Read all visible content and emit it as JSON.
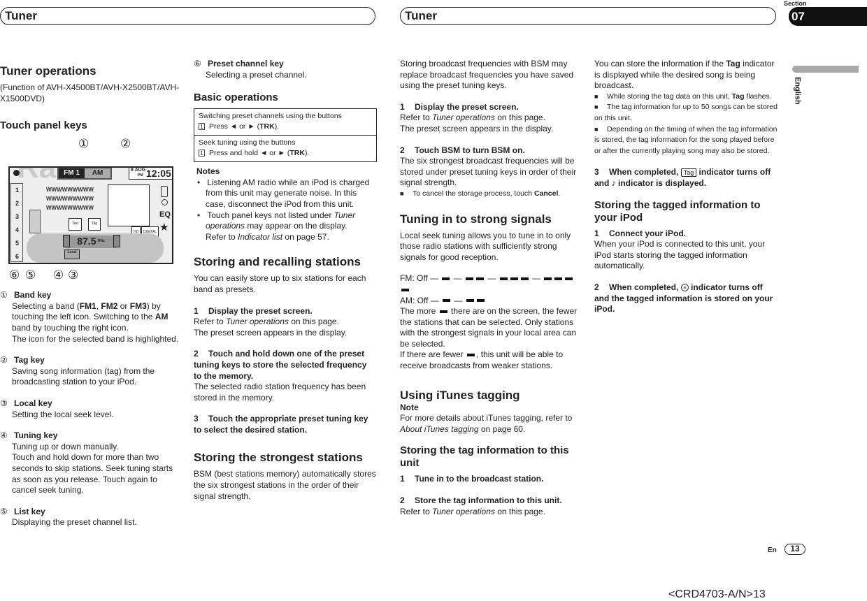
{
  "header": {
    "left_title": "Tuner",
    "right_title": "Tuner",
    "section_label": "Section",
    "section_number": "07",
    "language": "English"
  },
  "figure": {
    "radio_watermark": "Radio",
    "band_left": "FM 1",
    "band_right": "AM",
    "date": "8 AUG",
    "ampm": "PM",
    "time": "12:05",
    "text_lines": [
      "WWWWWWWWW",
      "WWWWWWWWW",
      "WWWWWWWWW"
    ],
    "text_button": "Text",
    "tag_button": "Tag",
    "hd": "HD",
    "digital": "DIGITAL",
    "frequency": "87.5",
    "unit": "MHz",
    "local": "Local",
    "eq": "EQ",
    "presets": [
      "1",
      "2",
      "3",
      "4",
      "5",
      "6"
    ],
    "callouts_top": [
      "①",
      "②"
    ],
    "callouts_bottom": [
      "⑥",
      "⑤",
      "④",
      "③"
    ]
  },
  "columns": [
    [
      {
        "t": "h1",
        "s": [
          "Tuner operations"
        ]
      },
      {
        "t": "p",
        "s": [
          "(Function of AVH-X4500BT/AVH-X2500BT/AVH-X1500DVD)"
        ]
      },
      {
        "t": "h2",
        "s": [
          "Touch panel keys"
        ],
        "style": "margin-top:22px"
      },
      {
        "t": "figure"
      },
      {
        "t": "item",
        "n": "①",
        "title": "Band key",
        "body": [
          [
            "Selecting a band (",
            {
              "b": "FM1"
            },
            ", ",
            {
              "b": "FM2"
            },
            " or ",
            {
              "b": "FM3"
            },
            ") by touching the left icon. Switching to the ",
            {
              "b": "AM"
            },
            " band by touching the right icon."
          ],
          [
            "The icon for the selected band is highlighted."
          ]
        ]
      },
      {
        "t": "gap"
      },
      {
        "t": "item",
        "n": "②",
        "title": "Tag key",
        "body": [
          [
            "Saving song information (tag) from the broadcasting station to your iPod."
          ]
        ]
      },
      {
        "t": "gap"
      },
      {
        "t": "item",
        "n": "③",
        "title": "Local key",
        "body": [
          [
            "Setting the local seek level."
          ]
        ]
      },
      {
        "t": "gap"
      },
      {
        "t": "item",
        "n": "④",
        "title": "Tuning key",
        "body": [
          [
            "Tuning up or down manually."
          ],
          [
            "Touch and hold down for more than two seconds to skip stations. Seek tuning starts as soon as you release. Touch again to cancel seek tuning."
          ]
        ]
      },
      {
        "t": "gap"
      },
      {
        "t": "item",
        "n": "⑤",
        "title": "List key",
        "body": [
          [
            "Displaying the preset channel list."
          ]
        ]
      }
    ],
    [
      {
        "t": "item",
        "n": "⑥",
        "title": "Preset channel key",
        "body": [
          [
            "Selecting a preset channel."
          ]
        ],
        "style": "margin-top:0"
      },
      {
        "t": "h2",
        "s": [
          "Basic operations"
        ],
        "style": "margin-top:16px"
      },
      {
        "t": "box",
        "rows": [
          {
            "title": "Switching preset channels using the buttons",
            "step": "1",
            "s": [
              "Press ◄ or ► (",
              {
                "b": "TRK"
              },
              ")."
            ]
          },
          {
            "title": "Seek tuning using the buttons",
            "step": "1",
            "s": [
              "Press and hold ◄ or ► (",
              {
                "b": "TRK"
              },
              ")."
            ]
          }
        ]
      },
      {
        "t": "noteh",
        "s": [
          "Notes"
        ]
      },
      {
        "t": "nb",
        "s": [
          "Listening AM radio while an iPod is charged from this unit may generate noise. In this case, disconnect the iPod from this unit."
        ]
      },
      {
        "t": "nb",
        "s": [
          "Touch panel keys not listed under ",
          {
            "i": "Tuner operations"
          },
          " may appear on the display."
        ]
      },
      {
        "t": "nbc",
        "s": [
          "Refer to ",
          {
            "i": "Indicator list"
          },
          " on page 57."
        ]
      },
      {
        "t": "h1",
        "s": [
          "Storing and recalling stations"
        ],
        "style": "margin-top:18px"
      },
      {
        "t": "p",
        "s": [
          "You can easily store up to six stations for each band as presets."
        ]
      },
      {
        "t": "gap"
      },
      {
        "t": "step",
        "n": "1",
        "s": [
          "Display the preset screen."
        ]
      },
      {
        "t": "p",
        "s": [
          "Refer to ",
          {
            "i": "Tuner operations"
          },
          " on this page."
        ]
      },
      {
        "t": "p",
        "s": [
          "The preset screen appears in the display."
        ]
      },
      {
        "t": "gap"
      },
      {
        "t": "step",
        "n": "2",
        "s": [
          "Touch and hold down one of the preset tuning keys to store the selected frequency to the memory."
        ]
      },
      {
        "t": "p",
        "s": [
          "The selected radio station frequency has been stored in the memory."
        ]
      },
      {
        "t": "gap"
      },
      {
        "t": "step",
        "n": "3",
        "s": [
          "Touch the appropriate preset tuning key to select the desired station."
        ]
      },
      {
        "t": "h1",
        "s": [
          "Storing the strongest stations"
        ],
        "style": "margin-top:22px"
      },
      {
        "t": "p",
        "s": [
          "BSM (best stations memory) automatically stores the six strongest stations in the order of their signal strength."
        ]
      }
    ],
    [
      {
        "t": "p",
        "s": [
          "Storing broadcast frequencies with BSM may replace broadcast frequencies you have saved using the preset tuning keys."
        ]
      },
      {
        "t": "gap"
      },
      {
        "t": "step",
        "n": "1",
        "s": [
          "Display the preset screen."
        ]
      },
      {
        "t": "p",
        "s": [
          "Refer to ",
          {
            "i": "Tuner operations"
          },
          " on this page."
        ]
      },
      {
        "t": "p",
        "s": [
          "The preset screen appears in the display."
        ]
      },
      {
        "t": "gap"
      },
      {
        "t": "step",
        "n": "2",
        "s": [
          "Touch BSM to turn BSM on."
        ]
      },
      {
        "t": "p",
        "s": [
          "The six strongest broadcast frequencies will be stored under preset tuning keys in order of their signal strength."
        ]
      },
      {
        "t": "bul",
        "s": [
          "To cancel the storage process, touch ",
          {
            "b": "Cancel"
          },
          "."
        ]
      },
      {
        "t": "h1",
        "s": [
          "Tuning in to strong signals"
        ],
        "style": "margin-top:18px"
      },
      {
        "t": "p",
        "s": [
          "Local seek tuning allows you to tune in to only those radio stations with sufficiently strong signals for good reception."
        ]
      },
      {
        "t": "gap"
      },
      {
        "t": "p",
        "s": [
          "FM: Off — ",
          {
            "icon": "bar"
          },
          " — ",
          {
            "icon": "bar"
          },
          {
            "icon": "bar"
          },
          " — ",
          {
            "icon": "bar"
          },
          {
            "icon": "bar"
          },
          {
            "icon": "bar"
          },
          " — ",
          {
            "icon": "bar"
          },
          {
            "icon": "bar"
          },
          {
            "icon": "bar"
          },
          {
            "icon": "bar"
          }
        ]
      },
      {
        "t": "p",
        "s": [
          "AM: Off — ",
          {
            "icon": "bar"
          },
          " — ",
          {
            "icon": "bar"
          },
          {
            "icon": "bar"
          }
        ]
      },
      {
        "t": "p",
        "s": [
          "The more ",
          {
            "icon": "bar"
          },
          " there are on the screen, the fewer the stations that can be selected. Only stations with the strongest signals in your local area can be selected."
        ]
      },
      {
        "t": "p",
        "s": [
          "If there are fewer ",
          {
            "icon": "bar"
          },
          ", this unit will be able to receive broadcasts from weaker stations."
        ]
      },
      {
        "t": "h1",
        "s": [
          "Using iTunes tagging"
        ],
        "style": "margin-top:24px;margin-bottom:0"
      },
      {
        "t": "step0",
        "s": [
          "Note"
        ]
      },
      {
        "t": "p",
        "s": [
          "For more details about iTunes tagging, refer to ",
          {
            "i": "About iTunes tagging"
          },
          " on page 60."
        ]
      },
      {
        "t": "h2",
        "s": [
          "Storing the tag information to this unit"
        ],
        "style": "margin-top:14px"
      },
      {
        "t": "step",
        "n": "1",
        "s": [
          "Tune in to the broadcast station."
        ]
      },
      {
        "t": "gap"
      },
      {
        "t": "step",
        "n": "2",
        "s": [
          "Store the tag information to this unit."
        ]
      },
      {
        "t": "p",
        "s": [
          "Refer to ",
          {
            "i": "Tuner operations"
          },
          " on this page."
        ]
      }
    ],
    [
      {
        "t": "p",
        "s": [
          "You can store the information if the ",
          {
            "b": "Tag"
          },
          " indicator is displayed while the desired song is being broadcast."
        ]
      },
      {
        "t": "bul",
        "s": [
          "While storing the tag data on this unit, ",
          {
            "b": "Tag"
          },
          " flashes."
        ]
      },
      {
        "t": "bul",
        "s": [
          "The tag information for up to 50 songs can be stored on this unit."
        ]
      },
      {
        "t": "bul",
        "s": [
          "Depending on the timing of when the tag information is stored, the tag information for the song played before or after the currently playing song may also be stored."
        ]
      },
      {
        "t": "gap"
      },
      {
        "t": "step",
        "n": "3",
        "s": [
          "When completed, ",
          {
            "icon": "tag",
            "label": "Tag"
          },
          " indicator turns off and ",
          {
            "icon": "note"
          },
          " indicator is displayed."
        ]
      },
      {
        "t": "h2",
        "s": [
          "Storing the tagged information to your iPod"
        ],
        "style": "margin-top:14px"
      },
      {
        "t": "step",
        "n": "1",
        "s": [
          "Connect your iPod."
        ]
      },
      {
        "t": "p",
        "s": [
          "When your iPod is connected to this unit, your iPod starts storing the tagged information automatically."
        ]
      },
      {
        "t": "gap"
      },
      {
        "t": "step",
        "n": "2",
        "s": [
          "When completed, ",
          {
            "icon": "ipod-tag"
          },
          " indicator turns off and the tagged information is stored on your iPod."
        ]
      }
    ]
  ],
  "footer": {
    "lang": "En",
    "page": "13",
    "code": "<CRD4703-A/N>13"
  }
}
